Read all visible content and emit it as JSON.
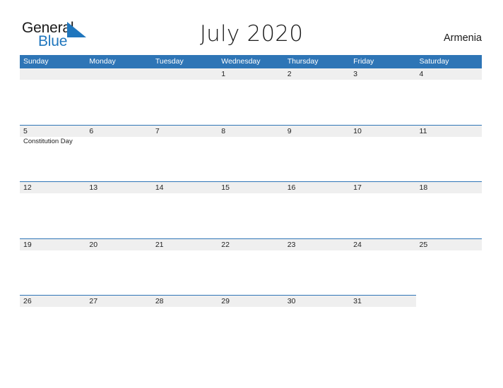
{
  "logo": {
    "word_one": "General",
    "word_two": "Blue",
    "triangle_color": "#1F76BD",
    "text_color": "#1a1a1a",
    "blue_text_color": "#1F76BD"
  },
  "header": {
    "title": "July 2020",
    "region": "Armenia"
  },
  "theme": {
    "header_blue": "#2E75B6",
    "band_gray": "#EFEFEF",
    "page_background": "#ffffff",
    "text_color": "#222222"
  },
  "calendar": {
    "month": "July",
    "year": "2020",
    "weekday_headers": [
      "Sunday",
      "Monday",
      "Tuesday",
      "Wednesday",
      "Thursday",
      "Friday",
      "Saturday"
    ],
    "weeks": [
      {
        "band_columns": 7,
        "days": [
          {
            "num": "",
            "event": ""
          },
          {
            "num": "",
            "event": ""
          },
          {
            "num": "",
            "event": ""
          },
          {
            "num": "1",
            "event": ""
          },
          {
            "num": "2",
            "event": ""
          },
          {
            "num": "3",
            "event": ""
          },
          {
            "num": "4",
            "event": ""
          }
        ]
      },
      {
        "band_columns": 7,
        "days": [
          {
            "num": "5",
            "event": "Constitution Day"
          },
          {
            "num": "6",
            "event": ""
          },
          {
            "num": "7",
            "event": ""
          },
          {
            "num": "8",
            "event": ""
          },
          {
            "num": "9",
            "event": ""
          },
          {
            "num": "10",
            "event": ""
          },
          {
            "num": "11",
            "event": ""
          }
        ]
      },
      {
        "band_columns": 7,
        "days": [
          {
            "num": "12",
            "event": ""
          },
          {
            "num": "13",
            "event": ""
          },
          {
            "num": "14",
            "event": ""
          },
          {
            "num": "15",
            "event": ""
          },
          {
            "num": "16",
            "event": ""
          },
          {
            "num": "17",
            "event": ""
          },
          {
            "num": "18",
            "event": ""
          }
        ]
      },
      {
        "band_columns": 7,
        "days": [
          {
            "num": "19",
            "event": ""
          },
          {
            "num": "20",
            "event": ""
          },
          {
            "num": "21",
            "event": ""
          },
          {
            "num": "22",
            "event": ""
          },
          {
            "num": "23",
            "event": ""
          },
          {
            "num": "24",
            "event": ""
          },
          {
            "num": "25",
            "event": ""
          }
        ]
      },
      {
        "band_columns": 6,
        "days": [
          {
            "num": "26",
            "event": ""
          },
          {
            "num": "27",
            "event": ""
          },
          {
            "num": "28",
            "event": ""
          },
          {
            "num": "29",
            "event": ""
          },
          {
            "num": "30",
            "event": ""
          },
          {
            "num": "31",
            "event": ""
          },
          {
            "num": "",
            "event": ""
          }
        ]
      }
    ]
  }
}
